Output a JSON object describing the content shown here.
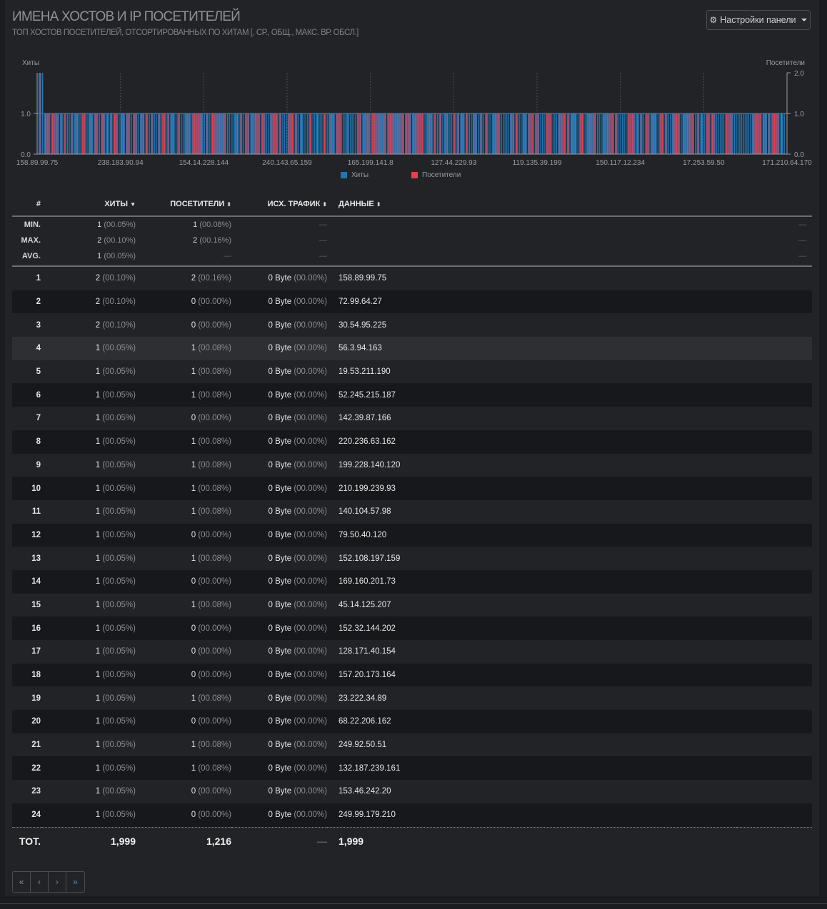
{
  "header": {
    "title": "ИМЕНА ХОСТОВ И IP ПОСЕТИТЕЛЕЙ",
    "subtitle": "ТОП ХОСТОВ ПОСЕТИТЕЛЕЙ, ОТСОРТИРОВАННЫХ ПО ХИТАМ [, СР., ОБЩ., МАКС. ВР. ОБСЛ.]",
    "settings_label": "Настройки панели",
    "settings_icon": "gear-icon"
  },
  "chart_data": {
    "type": "bar",
    "left_axis_label": "Хиты",
    "right_axis_label": "Посетители",
    "left_ticks": [
      "0.0",
      "1.0"
    ],
    "right_ticks": [
      "0.0",
      "1.0",
      "2.0"
    ],
    "x_tick_labels": [
      "158.89.99.75",
      "238.183.90.94",
      "154.14.228.144",
      "240.143.65.159",
      "165.199.141.8",
      "127.44.229.93",
      "119.135.39.199",
      "150.117.12.234",
      "17.253.59.50",
      "171.210.64.170"
    ],
    "series": [
      {
        "name": "Хиты",
        "color": "#1f77b4"
      },
      {
        "name": "Посетители",
        "color": "#ef3b4a"
      }
    ],
    "ylim_left": [
      0,
      2
    ],
    "ylim_right": [
      0,
      2
    ]
  },
  "table": {
    "columns": {
      "num": "#",
      "hits": "Хиты",
      "visitors": "Посетители",
      "tx": "Исх. трафик",
      "data": "Данные"
    },
    "stats": [
      {
        "label": "MIN.",
        "hits": "1",
        "hits_pct": "(00.05%)",
        "vis": "1",
        "vis_pct": "(00.08%)",
        "tx": "—",
        "extra": "—"
      },
      {
        "label": "MAX.",
        "hits": "2",
        "hits_pct": "(00.10%)",
        "vis": "2",
        "vis_pct": "(00.16%)",
        "tx": "—",
        "extra": "—"
      },
      {
        "label": "AVG.",
        "hits": "1",
        "hits_pct": "(00.05%)",
        "vis": "—",
        "vis_pct": "",
        "tx": "—",
        "extra": "—"
      }
    ],
    "rows": [
      {
        "n": "1",
        "hits": "2",
        "hits_pct": "(00.10%)",
        "vis": "2",
        "vis_pct": "(00.16%)",
        "tx": "0 Byte",
        "tx_pct": "(00.00%)",
        "data": "158.89.99.75"
      },
      {
        "n": "2",
        "hits": "2",
        "hits_pct": "(00.10%)",
        "vis": "0",
        "vis_pct": "(00.00%)",
        "tx": "0 Byte",
        "tx_pct": "(00.00%)",
        "data": "72.99.64.27"
      },
      {
        "n": "3",
        "hits": "2",
        "hits_pct": "(00.10%)",
        "vis": "0",
        "vis_pct": "(00.00%)",
        "tx": "0 Byte",
        "tx_pct": "(00.00%)",
        "data": "30.54.95.225"
      },
      {
        "n": "4",
        "hits": "1",
        "hits_pct": "(00.05%)",
        "vis": "1",
        "vis_pct": "(00.08%)",
        "tx": "0 Byte",
        "tx_pct": "(00.00%)",
        "data": "56.3.94.163"
      },
      {
        "n": "5",
        "hits": "1",
        "hits_pct": "(00.05%)",
        "vis": "1",
        "vis_pct": "(00.08%)",
        "tx": "0 Byte",
        "tx_pct": "(00.00%)",
        "data": "19.53.211.190"
      },
      {
        "n": "6",
        "hits": "1",
        "hits_pct": "(00.05%)",
        "vis": "1",
        "vis_pct": "(00.08%)",
        "tx": "0 Byte",
        "tx_pct": "(00.00%)",
        "data": "52.245.215.187"
      },
      {
        "n": "7",
        "hits": "1",
        "hits_pct": "(00.05%)",
        "vis": "0",
        "vis_pct": "(00.00%)",
        "tx": "0 Byte",
        "tx_pct": "(00.00%)",
        "data": "142.39.87.166"
      },
      {
        "n": "8",
        "hits": "1",
        "hits_pct": "(00.05%)",
        "vis": "1",
        "vis_pct": "(00.08%)",
        "tx": "0 Byte",
        "tx_pct": "(00.00%)",
        "data": "220.236.63.162"
      },
      {
        "n": "9",
        "hits": "1",
        "hits_pct": "(00.05%)",
        "vis": "1",
        "vis_pct": "(00.08%)",
        "tx": "0 Byte",
        "tx_pct": "(00.00%)",
        "data": "199.228.140.120"
      },
      {
        "n": "10",
        "hits": "1",
        "hits_pct": "(00.05%)",
        "vis": "1",
        "vis_pct": "(00.08%)",
        "tx": "0 Byte",
        "tx_pct": "(00.00%)",
        "data": "210.199.239.93"
      },
      {
        "n": "11",
        "hits": "1",
        "hits_pct": "(00.05%)",
        "vis": "1",
        "vis_pct": "(00.08%)",
        "tx": "0 Byte",
        "tx_pct": "(00.00%)",
        "data": "140.104.57.98"
      },
      {
        "n": "12",
        "hits": "1",
        "hits_pct": "(00.05%)",
        "vis": "0",
        "vis_pct": "(00.00%)",
        "tx": "0 Byte",
        "tx_pct": "(00.00%)",
        "data": "79.50.40.120"
      },
      {
        "n": "13",
        "hits": "1",
        "hits_pct": "(00.05%)",
        "vis": "1",
        "vis_pct": "(00.08%)",
        "tx": "0 Byte",
        "tx_pct": "(00.00%)",
        "data": "152.108.197.159"
      },
      {
        "n": "14",
        "hits": "1",
        "hits_pct": "(00.05%)",
        "vis": "0",
        "vis_pct": "(00.00%)",
        "tx": "0 Byte",
        "tx_pct": "(00.00%)",
        "data": "169.160.201.73"
      },
      {
        "n": "15",
        "hits": "1",
        "hits_pct": "(00.05%)",
        "vis": "1",
        "vis_pct": "(00.08%)",
        "tx": "0 Byte",
        "tx_pct": "(00.00%)",
        "data": "45.14.125.207"
      },
      {
        "n": "16",
        "hits": "1",
        "hits_pct": "(00.05%)",
        "vis": "0",
        "vis_pct": "(00.00%)",
        "tx": "0 Byte",
        "tx_pct": "(00.00%)",
        "data": "152.32.144.202"
      },
      {
        "n": "17",
        "hits": "1",
        "hits_pct": "(00.05%)",
        "vis": "0",
        "vis_pct": "(00.00%)",
        "tx": "0 Byte",
        "tx_pct": "(00.00%)",
        "data": "128.171.40.154"
      },
      {
        "n": "18",
        "hits": "1",
        "hits_pct": "(00.05%)",
        "vis": "0",
        "vis_pct": "(00.00%)",
        "tx": "0 Byte",
        "tx_pct": "(00.00%)",
        "data": "157.20.173.164"
      },
      {
        "n": "19",
        "hits": "1",
        "hits_pct": "(00.05%)",
        "vis": "1",
        "vis_pct": "(00.08%)",
        "tx": "0 Byte",
        "tx_pct": "(00.00%)",
        "data": "23.222.34.89"
      },
      {
        "n": "20",
        "hits": "1",
        "hits_pct": "(00.05%)",
        "vis": "0",
        "vis_pct": "(00.00%)",
        "tx": "0 Byte",
        "tx_pct": "(00.00%)",
        "data": "68.22.206.162"
      },
      {
        "n": "21",
        "hits": "1",
        "hits_pct": "(00.05%)",
        "vis": "1",
        "vis_pct": "(00.08%)",
        "tx": "0 Byte",
        "tx_pct": "(00.00%)",
        "data": "249.92.50.51"
      },
      {
        "n": "22",
        "hits": "1",
        "hits_pct": "(00.05%)",
        "vis": "1",
        "vis_pct": "(00.08%)",
        "tx": "0 Byte",
        "tx_pct": "(00.00%)",
        "data": "132.187.239.161"
      },
      {
        "n": "23",
        "hits": "1",
        "hits_pct": "(00.05%)",
        "vis": "0",
        "vis_pct": "(00.00%)",
        "tx": "0 Byte",
        "tx_pct": "(00.00%)",
        "data": "153.46.242.20"
      },
      {
        "n": "24",
        "hits": "1",
        "hits_pct": "(00.05%)",
        "vis": "0",
        "vis_pct": "(00.00%)",
        "tx": "0 Byte",
        "tx_pct": "(00.00%)",
        "data": "249.99.179.210"
      }
    ],
    "highlighted_row": "4",
    "total": {
      "label": "TOT.",
      "hits": "1,999",
      "vis": "1,216",
      "tx": "—",
      "data": "1,999"
    }
  },
  "pagination": {
    "first": "«",
    "prev": "‹",
    "next": "›",
    "last": "»"
  }
}
